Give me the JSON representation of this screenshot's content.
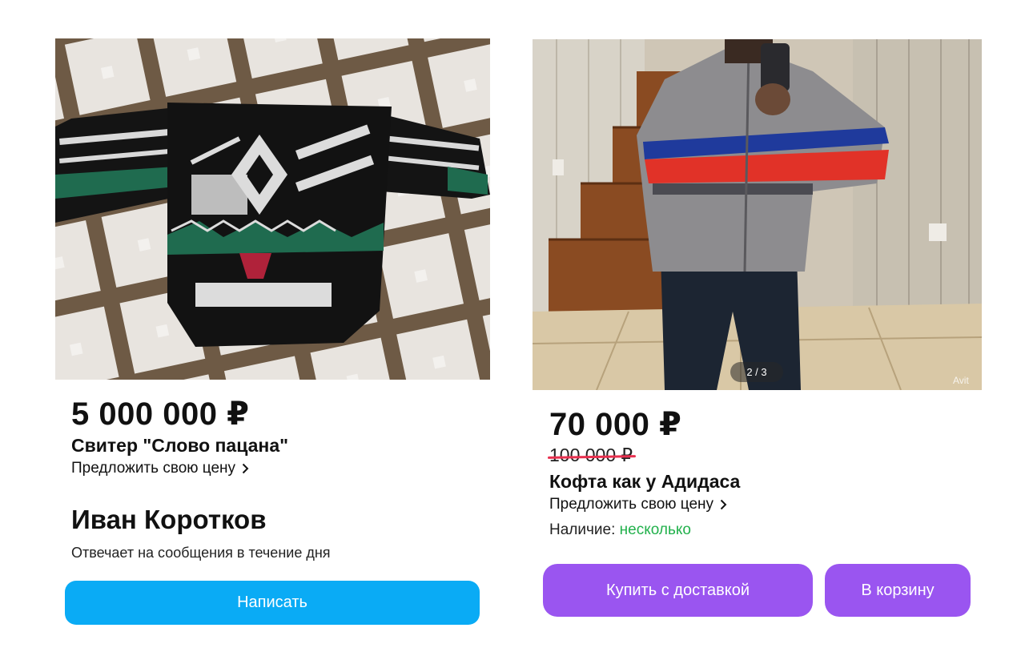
{
  "left_listing": {
    "price": "5 000 000 ₽",
    "title": "Свитер \"Слово пацана\"",
    "offer_price_label": "Предложить свою цену",
    "seller_name": "Иван Коротков",
    "seller_response": "Отвечает на сообщения в течение дня",
    "message_button": "Написать",
    "accent_color": "#0aabf5"
  },
  "right_listing": {
    "price": "70 000 ₽",
    "old_price": "100 000 ₽",
    "title": "Кофта как у Адидаса",
    "offer_price_label": "Предложить свою цену",
    "availability_label": "Наличие:",
    "availability_value": "несколько",
    "availability_color": "#22b14c",
    "photo_counter": "2 / 3",
    "watermark": "Avit",
    "buy_button": "Купить с доставкой",
    "cart_button": "В корзину",
    "accent_color": "#9a55f0"
  }
}
